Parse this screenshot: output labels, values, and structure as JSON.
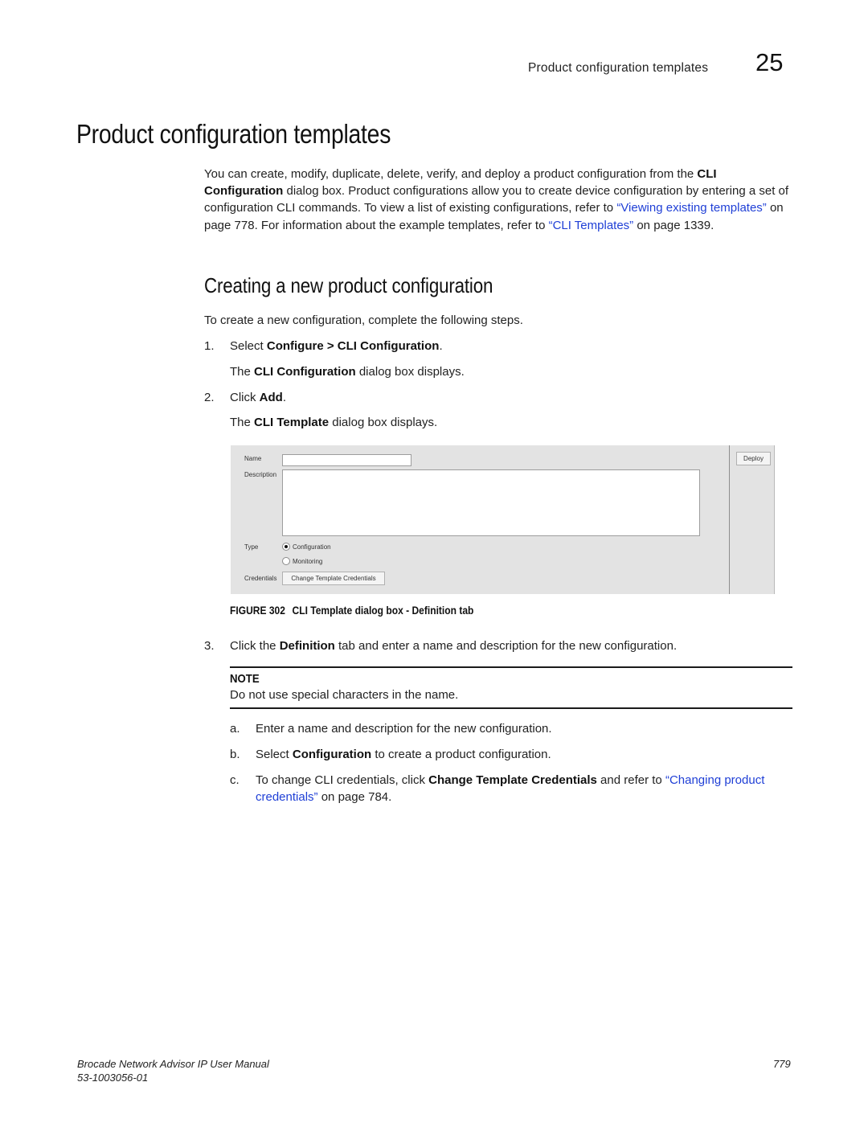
{
  "header": {
    "running_title": "Product configuration templates",
    "chapter_number": "25"
  },
  "title": "Product configuration templates",
  "intro": {
    "part1": "You can create, modify, duplicate, delete, verify, and deploy a product configuration from the ",
    "bold1": "CLI Configuration",
    "part2": " dialog box. Product configurations allow you to create device configuration by entering a set of configuration CLI commands. To view a list of existing configurations, refer to ",
    "link1": "“Viewing existing templates”",
    "part3": " on page 778. For information about the example templates, refer to ",
    "link2": "“CLI Templates”",
    "part4": " on page 1339."
  },
  "section": {
    "heading": "Creating a new product configuration",
    "lead": "To create a new configuration, complete the following steps."
  },
  "steps": [
    {
      "num": "1.",
      "pre": "Select ",
      "bold": "Configure > CLI Configuration",
      "post": ".",
      "result_pre": "The ",
      "result_bold": "CLI Configuration",
      "result_post": " dialog box displays."
    },
    {
      "num": "2.",
      "pre": "Click ",
      "bold": "Add",
      "post": ".",
      "result_pre": "The ",
      "result_bold": "CLI Template",
      "result_post": " dialog box displays."
    },
    {
      "num": "3.",
      "pre": "Click the ",
      "bold": "Definition",
      "post": " tab and enter a name and description for the new configuration."
    }
  ],
  "dialog": {
    "name_label": "Name",
    "name_value": "",
    "description_label": "Description",
    "description_value": "",
    "type_label": "Type",
    "type_options": [
      {
        "label": "Configuration",
        "selected": true
      },
      {
        "label": "Monitoring",
        "selected": false
      }
    ],
    "credentials_label": "Credentials",
    "change_credentials_button": "Change Template Credentials",
    "deploy_button": "Deploy"
  },
  "figure": {
    "label": "FIGURE 302",
    "caption": "CLI Template dialog box - Definition tab"
  },
  "note": {
    "heading": "NOTE",
    "text": "Do not use special characters in the name."
  },
  "substeps": [
    {
      "letter": "a.",
      "pre": "Enter a name and description for the new configuration."
    },
    {
      "letter": "b.",
      "pre": "Select ",
      "bold": "Configuration",
      "post": " to create a product configuration."
    },
    {
      "letter": "c.",
      "pre": "To change CLI credentials, click ",
      "bold": "Change Template Credentials",
      "mid": " and refer to ",
      "link": "“Changing product credentials”",
      "post": " on page 784."
    }
  ],
  "footer": {
    "manual_title": "Brocade Network Advisor IP User Manual",
    "doc_number": "53-1003056-01",
    "page_number": "779"
  },
  "colors": {
    "link": "#1f3fd6",
    "dialog_bg": "#e3e3e3"
  }
}
